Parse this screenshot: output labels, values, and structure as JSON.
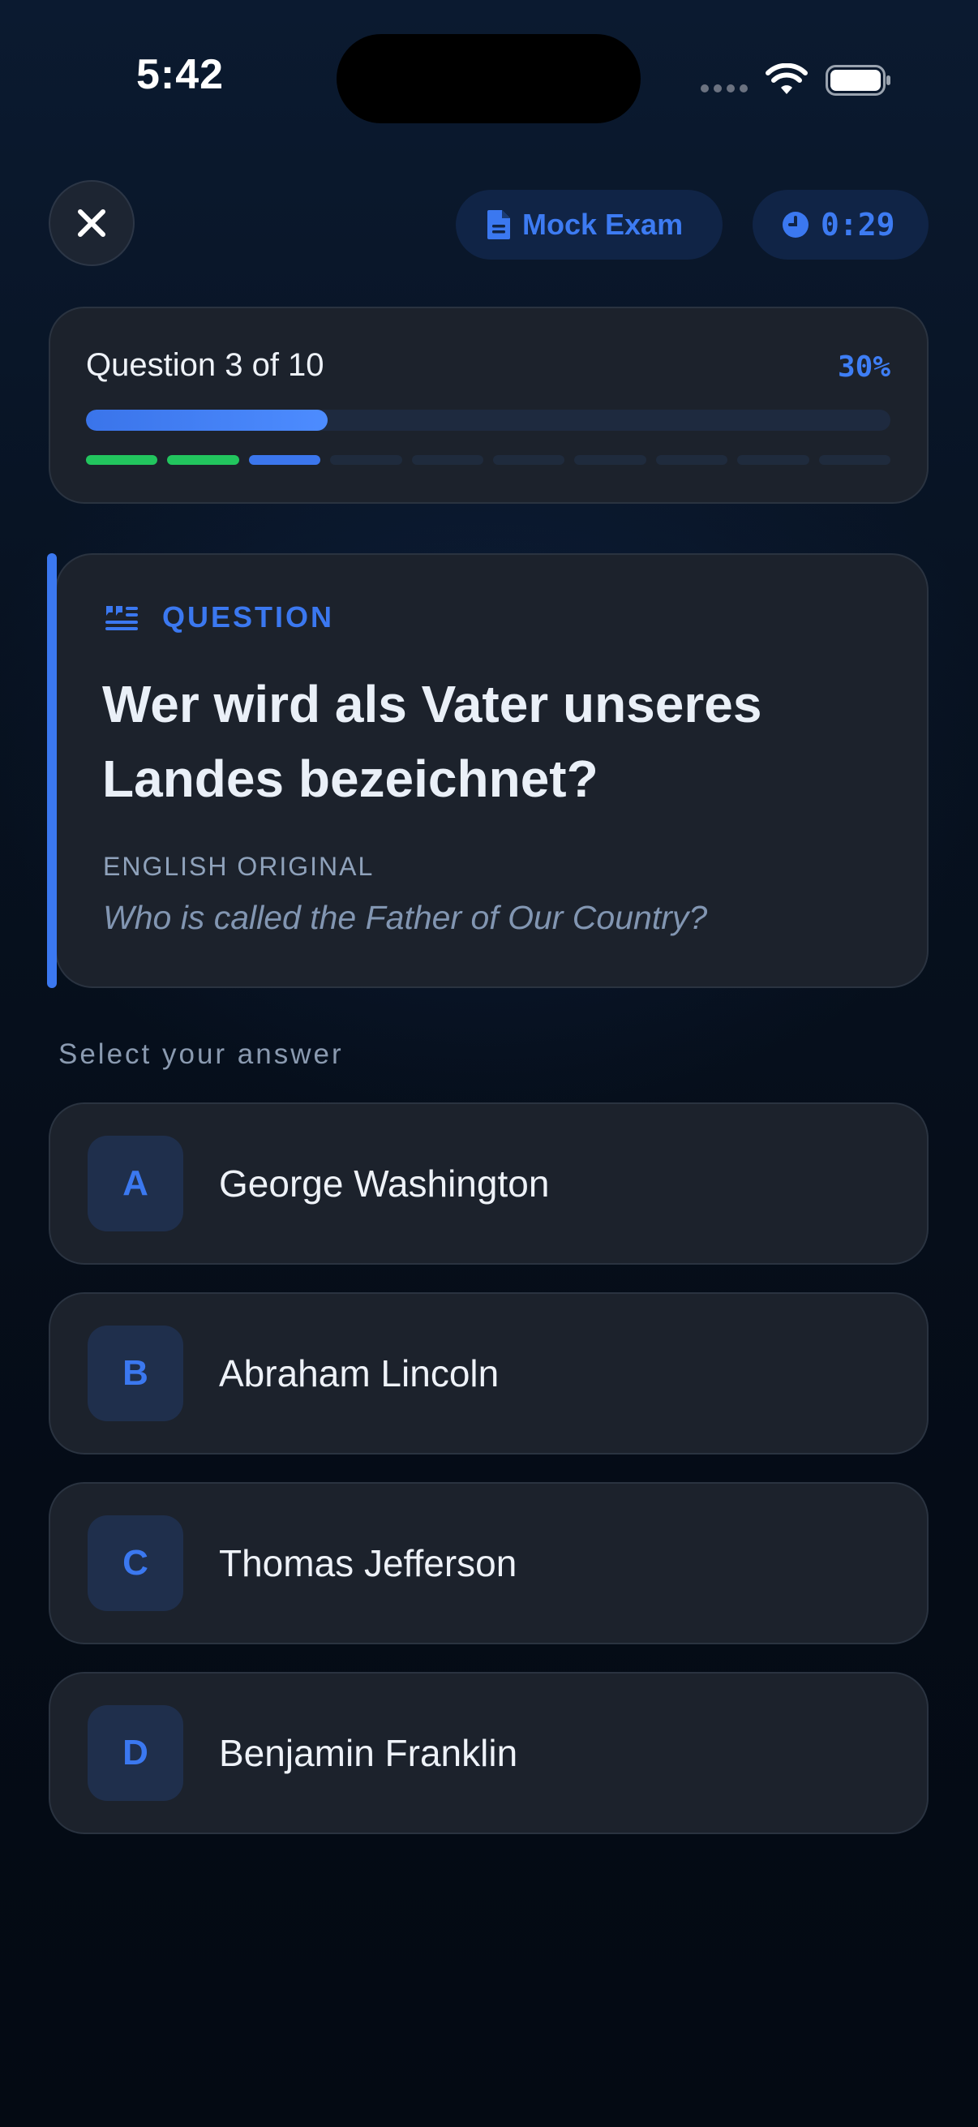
{
  "status_bar": {
    "time": "5:42"
  },
  "header": {
    "close_icon": "close-icon",
    "mode_label": "Mock Exam",
    "mode_icon": "document-icon",
    "timer": "0:29",
    "timer_icon": "clock-icon"
  },
  "progress": {
    "label": "Question 3 of 10",
    "percent_label": "30%",
    "fraction": 0.3,
    "current": 3,
    "total": 10,
    "completed": 2
  },
  "question": {
    "tag_label": "QUESTION",
    "tag_icon": "quote-icon",
    "text": "Wer wird als Vater unseres Landes bezeichnet?",
    "original_label": "ENGLISH ORIGINAL",
    "original_text": "Who is called the Father of Our Country?"
  },
  "answers": {
    "prompt": "Select your answer",
    "options": [
      {
        "letter": "A",
        "text": "George Washington"
      },
      {
        "letter": "B",
        "text": "Abraham Lincoln"
      },
      {
        "letter": "C",
        "text": "Thomas Jefferson"
      },
      {
        "letter": "D",
        "text": "Benjamin Franklin"
      }
    ]
  },
  "colors": {
    "accent": "#3b78f0",
    "done": "#22c55e",
    "card": "#1c222c",
    "background": "#060d18"
  }
}
